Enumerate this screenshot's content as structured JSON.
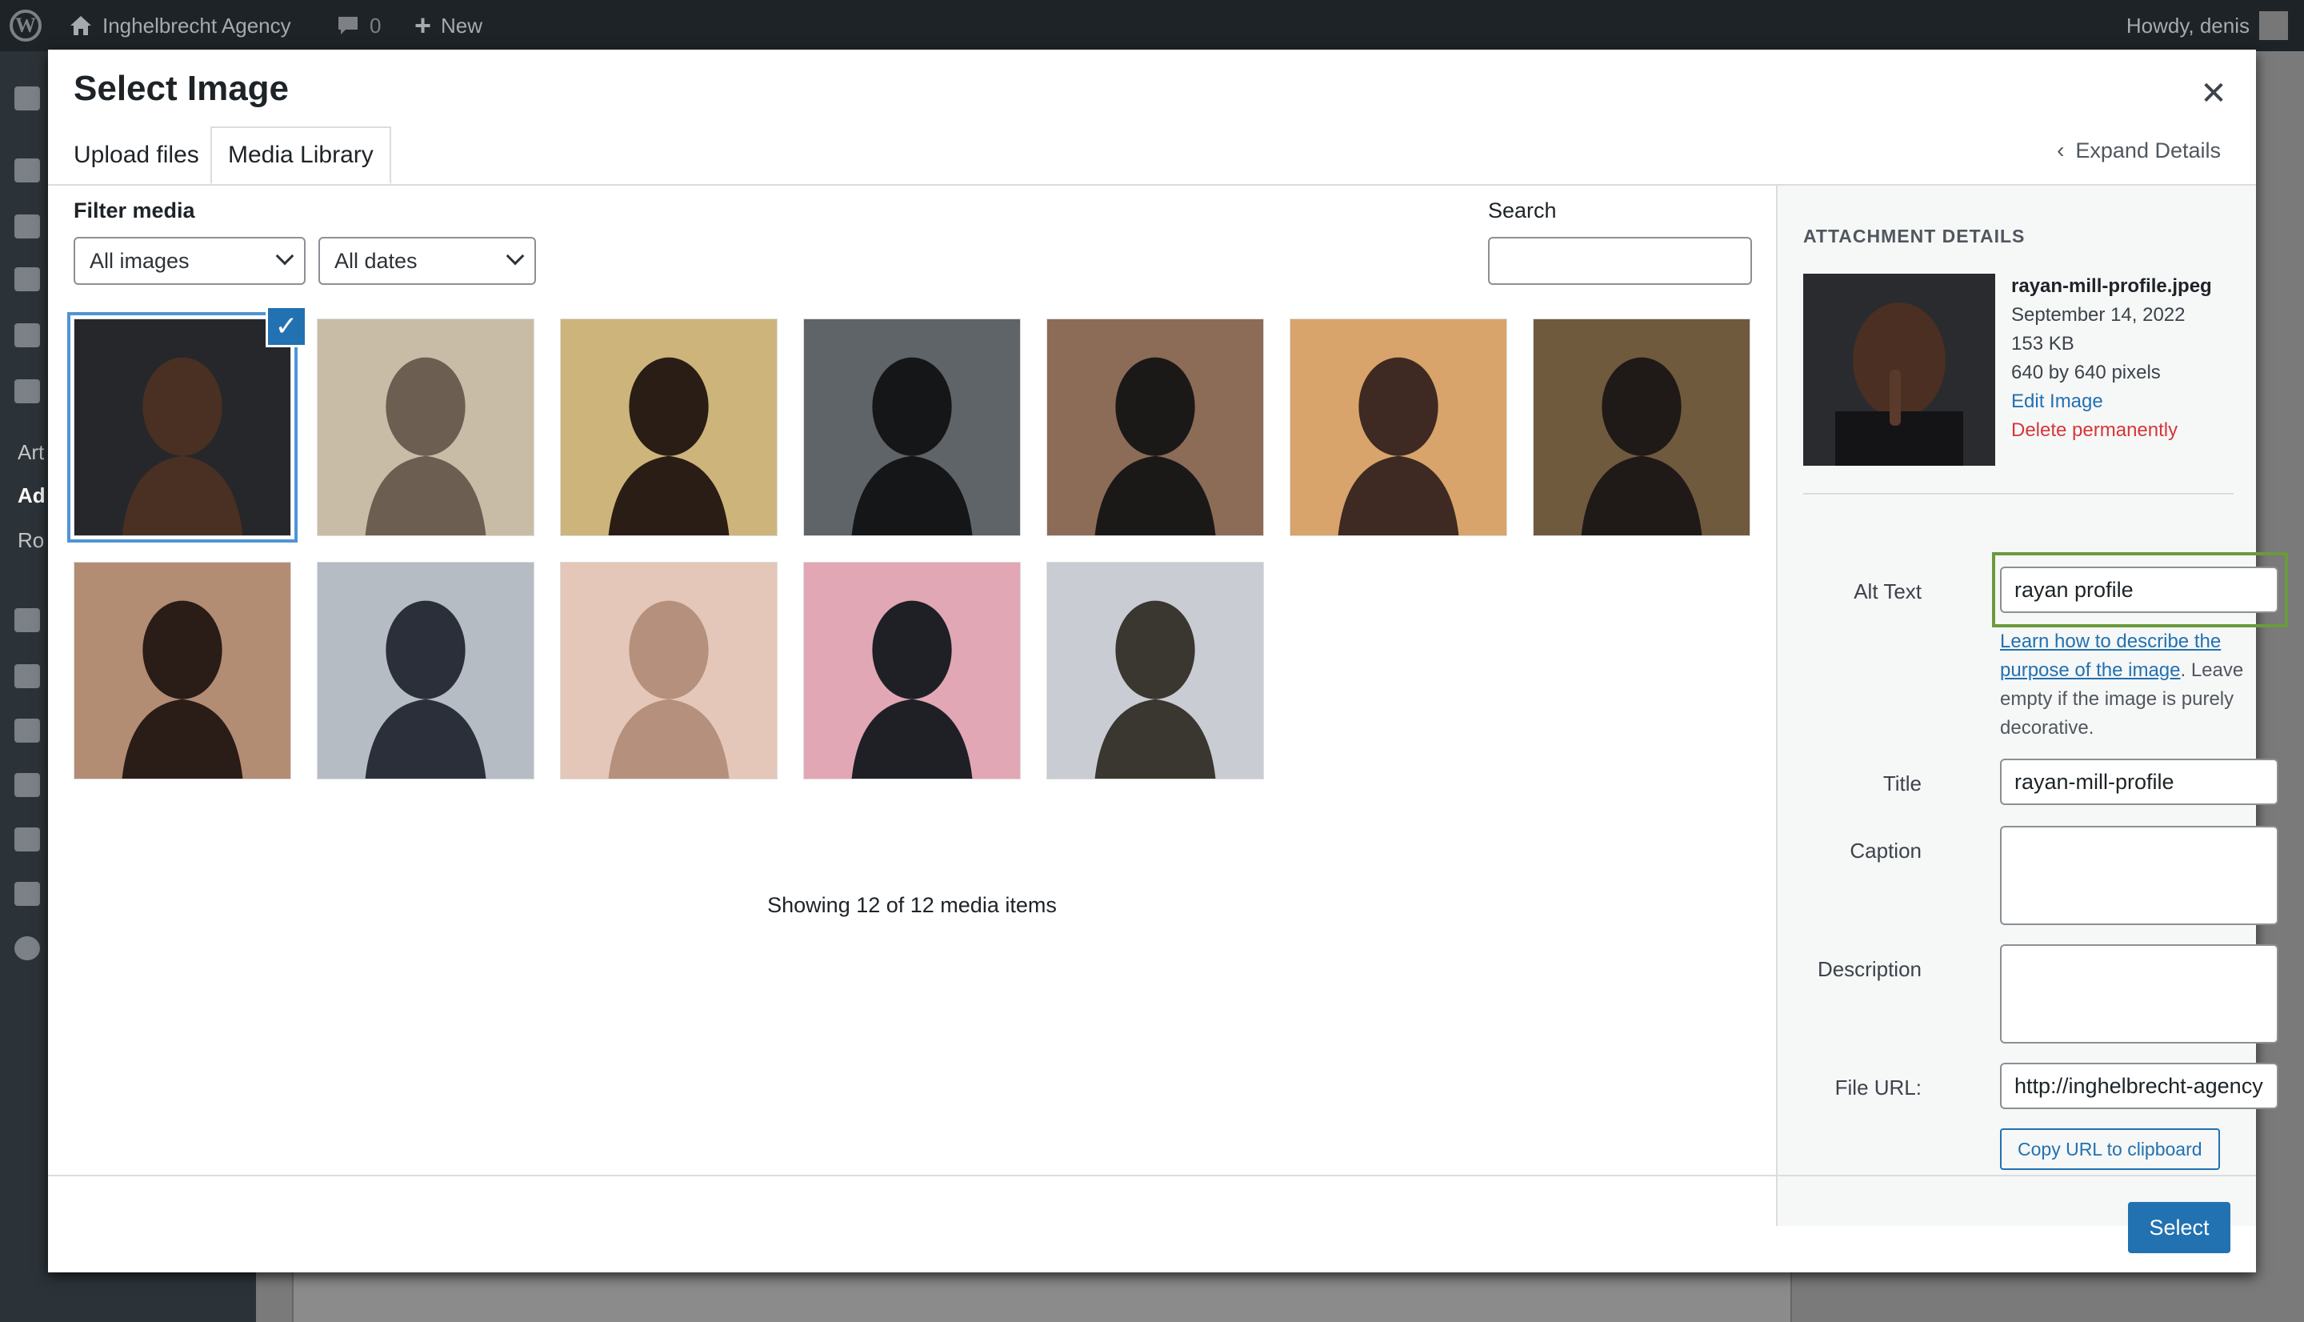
{
  "admin_bar": {
    "site_name": "Inghelbrecht Agency",
    "comments_count": "0",
    "new_label": "New",
    "howdy": "Howdy, denis"
  },
  "sidebar_fragments": [
    "Art",
    "Ad",
    "Ro"
  ],
  "modal": {
    "title": "Select Image",
    "close_icon": "close-icon",
    "tabs": [
      {
        "label": "Upload files",
        "active": false
      },
      {
        "label": "Media Library",
        "active": true
      }
    ],
    "expand_details": "Expand Details"
  },
  "filters": {
    "label": "Filter media",
    "type_selected": "All images",
    "date_selected": "All dates",
    "search_label": "Search",
    "search_value": ""
  },
  "media_grid": {
    "items": [
      {
        "index": 1,
        "selected": true,
        "palette": [
          "#26272b",
          "#4a3022"
        ]
      },
      {
        "index": 2,
        "selected": false,
        "palette": [
          "#c9bca7",
          "#6c5e50"
        ]
      },
      {
        "index": 3,
        "selected": false,
        "palette": [
          "#cdb47a",
          "#2a1d16"
        ]
      },
      {
        "index": 4,
        "selected": false,
        "palette": [
          "#5f6468",
          "#151617"
        ]
      },
      {
        "index": 5,
        "selected": false,
        "palette": [
          "#8c6c57",
          "#1b1818"
        ]
      },
      {
        "index": 6,
        "selected": false,
        "palette": [
          "#d8a46b",
          "#3e2a22"
        ]
      },
      {
        "index": 7,
        "selected": false,
        "palette": [
          "#6f5a3e",
          "#1f1a18"
        ]
      },
      {
        "index": 8,
        "selected": false,
        "palette": [
          "#b38c74",
          "#2a1c17"
        ]
      },
      {
        "index": 9,
        "selected": false,
        "palette": [
          "#b6bcc4",
          "#2a2f3a"
        ]
      },
      {
        "index": 10,
        "selected": false,
        "palette": [
          "#e4c7b8",
          "#b5907c"
        ]
      },
      {
        "index": 11,
        "selected": false,
        "palette": [
          "#e2a7b5",
          "#1e2026"
        ]
      },
      {
        "index": 12,
        "selected": false,
        "palette": [
          "#c9ccd2",
          "#3a3630"
        ]
      }
    ],
    "showing_text": "Showing 12 of 12 media items"
  },
  "attachment_details": {
    "heading": "ATTACHMENT DETAILS",
    "filename": "rayan-mill-profile.jpeg",
    "date": "September 14, 2022",
    "size": "153 KB",
    "dimensions": "640 by 640 pixels",
    "edit_link": "Edit Image",
    "delete_link": "Delete permanently",
    "alt_text_label": "Alt Text",
    "alt_text_value": "rayan profile",
    "alt_help_link": "Learn how to describe the purpose of the image",
    "alt_help_rest": ". Leave empty if the image is purely decorative.",
    "title_label": "Title",
    "title_value": "rayan-mill-profile",
    "caption_label": "Caption",
    "caption_value": "",
    "description_label": "Description",
    "description_value": "",
    "file_url_label": "File URL:",
    "file_url_value": "http://inghelbrecht-agency",
    "copy_url_button": "Copy URL to clipboard"
  },
  "footer": {
    "select_button": "Select"
  },
  "colors": {
    "accent": "#2271b1",
    "danger": "#d63638",
    "alt_highlight": "#6a9a3c",
    "admin_bar": "#1d2327"
  }
}
